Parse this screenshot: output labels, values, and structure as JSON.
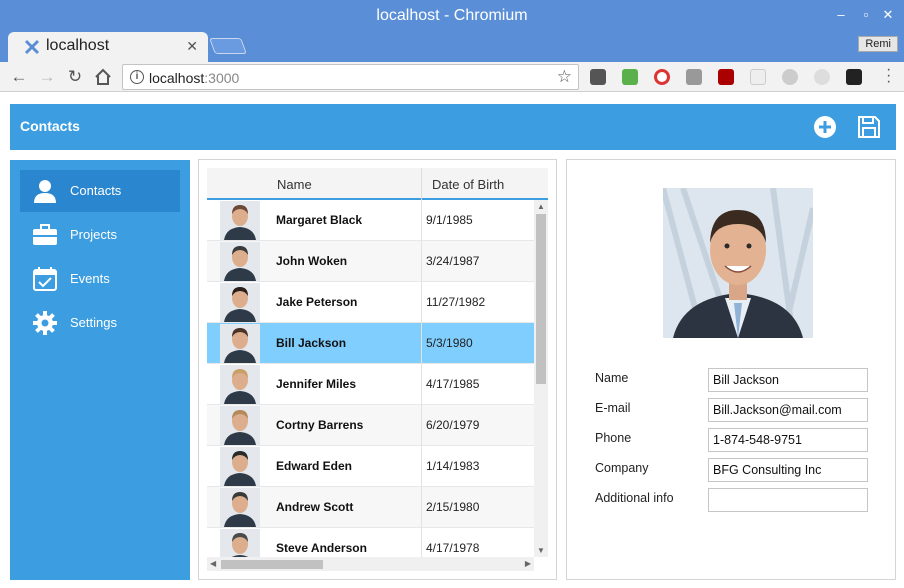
{
  "window": {
    "title": "localhost - Chromium"
  },
  "browser": {
    "tab_title": "localhost",
    "profile_name": "Remi",
    "url_host": "localhost",
    "url_port": ":3000"
  },
  "app": {
    "header_title": "Contacts",
    "sidebar": [
      {
        "label": "Contacts",
        "icon": "user-icon"
      },
      {
        "label": "Projects",
        "icon": "briefcase-icon"
      },
      {
        "label": "Events",
        "icon": "calendar-icon"
      },
      {
        "label": "Settings",
        "icon": "gear-icon"
      }
    ],
    "grid": {
      "columns": [
        "Name",
        "Date of Birth"
      ],
      "rows": [
        {
          "name": "Margaret Black",
          "dob": "9/1/1985"
        },
        {
          "name": "John Woken",
          "dob": "3/24/1987"
        },
        {
          "name": "Jake Peterson",
          "dob": "11/27/1982"
        },
        {
          "name": "Bill Jackson",
          "dob": "5/3/1980"
        },
        {
          "name": "Jennifer Miles",
          "dob": "4/17/1985"
        },
        {
          "name": "Cortny Barrens",
          "dob": "6/20/1979"
        },
        {
          "name": "Edward Eden",
          "dob": "1/14/1983"
        },
        {
          "name": "Andrew Scott",
          "dob": "2/15/1980"
        },
        {
          "name": "Steve Anderson",
          "dob": "4/17/1978"
        }
      ],
      "selected_index": 3
    },
    "details": {
      "labels": {
        "name": "Name",
        "email": "E-mail",
        "phone": "Phone",
        "company": "Company",
        "info": "Additional info"
      },
      "values": {
        "name": "Bill Jackson",
        "email": "Bill.Jackson@mail.com",
        "phone": "1-874-548-9751",
        "company": "BFG Consulting Inc",
        "info": ""
      }
    }
  },
  "colors": {
    "accent": "#3c9ee0",
    "selected_row": "#7fcefe",
    "titlebar": "#5a8fd8"
  }
}
